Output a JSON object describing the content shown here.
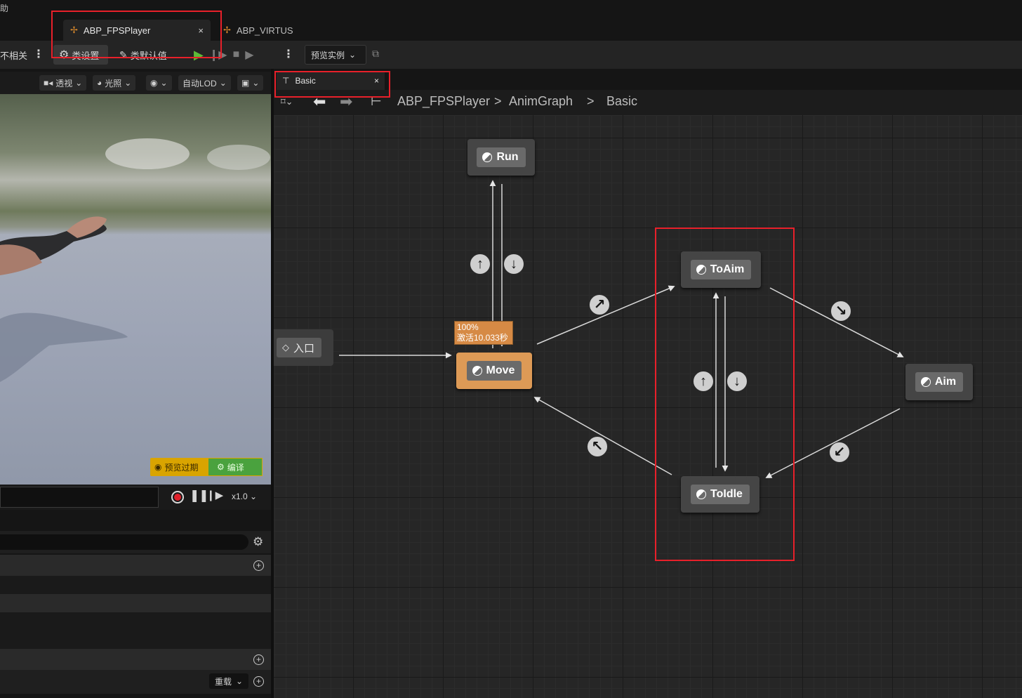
{
  "menubar": {
    "partial_label": "助"
  },
  "tabs": [
    {
      "label": "ABP_FPSPlayer",
      "active": true,
      "close": "×"
    },
    {
      "label": "ABP_VIRTUS",
      "active": false
    }
  ],
  "toolbar": {
    "partial_label": "不相关",
    "class_settings": "类设置",
    "class_defaults": "类默认值",
    "preview_instance": "预览实例"
  },
  "viewport_toolbar": {
    "perspective": "透视",
    "lighting": "光照",
    "lod": "自动LOD"
  },
  "viewport": {
    "preview_expired": "预览过期",
    "compile": "编译"
  },
  "playback": {
    "speed": "x1.0"
  },
  "details": {
    "overload": "重载"
  },
  "graph_tab": {
    "label": "Basic",
    "close": "×"
  },
  "breadcrumb": [
    "ABP_FPSPlayer",
    "AnimGraph",
    "Basic"
  ],
  "graph": {
    "entry_label": "入口",
    "states": {
      "run": "Run",
      "move": "Move",
      "to_aim": "ToAim",
      "aim": "Aim",
      "to_idle": "ToIdle"
    },
    "debug": {
      "weight": "100%",
      "active_time": "激活10.033秒"
    }
  },
  "colors": {
    "accent_orange": "#dd9a56",
    "play_green": "#5dbb38",
    "highlight_red": "#e8202a",
    "compile_green": "#4aa23e",
    "warning_yellow": "#d9a400"
  }
}
